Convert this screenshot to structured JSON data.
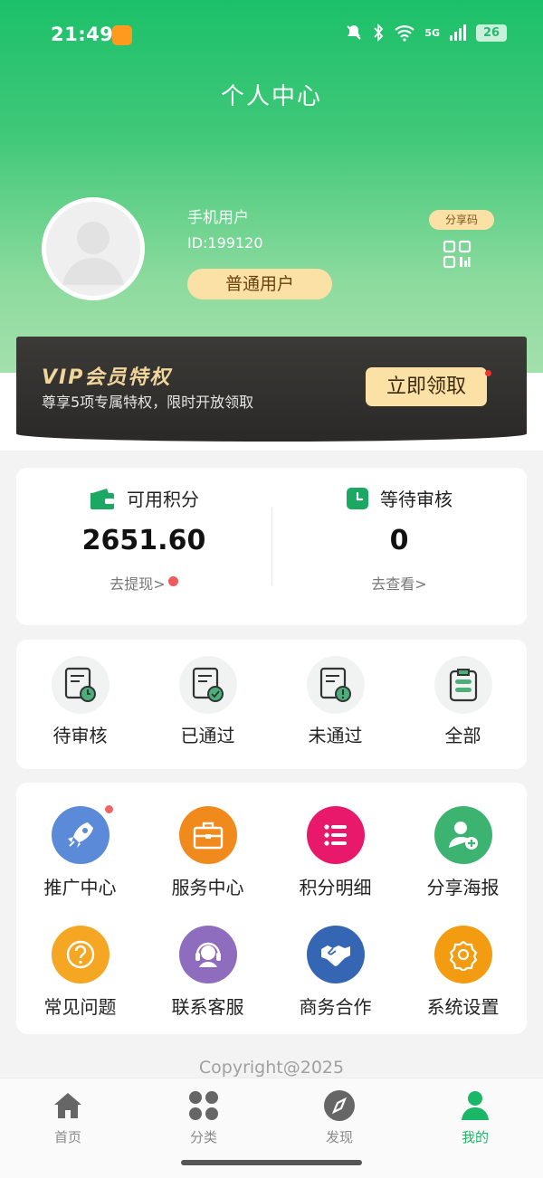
{
  "status_bar": {
    "time": "21:49",
    "battery": "26",
    "network": "5G"
  },
  "page_title": "个人中心",
  "user": {
    "name": "手机用户",
    "id": "ID:199120",
    "level": "普通用户",
    "share_label": "分享码"
  },
  "vip": {
    "title": "VIP会员特权",
    "subtitle": "尊享5项专属特权，限时开放领取",
    "button": "立即领取"
  },
  "points": [
    {
      "label": "可用积分",
      "value": "2651.60",
      "link": "去提现>",
      "icon": "wallet-icon",
      "has_dot": true
    },
    {
      "label": "等待审核",
      "value": "0",
      "link": "去查看>",
      "icon": "clock-icon",
      "has_dot": false
    }
  ],
  "review_status": [
    {
      "label": "待审核",
      "icon": "doc-pending-icon"
    },
    {
      "label": "已通过",
      "icon": "doc-approved-icon"
    },
    {
      "label": "未通过",
      "icon": "doc-rejected-icon"
    },
    {
      "label": "全部",
      "icon": "clipboard-all-icon"
    }
  ],
  "services": [
    {
      "label": "推广中心",
      "icon": "rocket-icon",
      "color": "#5b8ad8",
      "badge": true
    },
    {
      "label": "服务中心",
      "icon": "briefcase-icon",
      "color": "#f08a1c",
      "badge": false
    },
    {
      "label": "积分明细",
      "icon": "list-icon",
      "color": "#e8196a",
      "badge": false
    },
    {
      "label": "分享海报",
      "icon": "add-user-icon",
      "color": "#3cb371",
      "badge": false
    },
    {
      "label": "常见问题",
      "icon": "question-icon",
      "color": "#f5a623",
      "badge": false
    },
    {
      "label": "联系客服",
      "icon": "headset-icon",
      "color": "#8e6dbf",
      "badge": false
    },
    {
      "label": "商务合作",
      "icon": "handshake-icon",
      "color": "#3566b4",
      "badge": false
    },
    {
      "label": "系统设置",
      "icon": "settings-icon",
      "color": "#f39c12",
      "badge": false
    }
  ],
  "copyright": "Copyright@2025",
  "tabs": [
    {
      "label": "首页",
      "icon": "home-icon",
      "active": false
    },
    {
      "label": "分类",
      "icon": "category-icon",
      "active": false
    },
    {
      "label": "发现",
      "icon": "compass-icon",
      "active": false
    },
    {
      "label": "我的",
      "icon": "profile-icon",
      "active": true
    }
  ],
  "colors": {
    "primary": "#1ab866",
    "vip_gold": "#f1d59b",
    "badge_red": "#ef5b5b"
  }
}
